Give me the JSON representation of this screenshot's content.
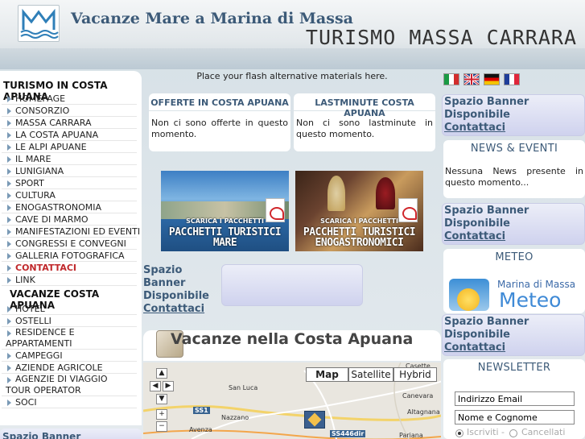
{
  "header": {
    "title": "Vacanze Mare a Marina di Massa",
    "subtitle": "TURISMO MASSA CARRARA"
  },
  "left_menu": {
    "section1_title": "TURISMO IN COSTA APUANA",
    "items": [
      "HOMEPAGE",
      "CONSORZIO",
      "MASSA CARRARA",
      "LA COSTA APUANA",
      "LE ALPI APUANE",
      "IL MARE",
      "LUNIGIANA",
      "SPORT",
      "CULTURA",
      "ENOGASTRONOMIA",
      "CAVE DI MARMO",
      "MANIFESTAZIONI ED EVENTI",
      "CONGRESSI E CONVEGNI",
      "GALLERIA FOTOGRAFICA",
      "CONTATTACI",
      "LINK"
    ],
    "section2_title": "VACANZE COSTA APUANA",
    "items2": [
      "HOTEL",
      "OSTELLI",
      "RESIDENCE E",
      "APPARTAMENTI",
      "CAMPEGGI",
      "AZIENDE AGRICOLE",
      "AGENZIE DI VIAGGIO",
      "TOUR OPERATOR",
      "SOCI"
    ],
    "bottom_banner": "Spazio Banner"
  },
  "center": {
    "flash_note": "Place your flash alternative materials here.",
    "offers_title": "OFFERTE IN COSTA APUANA",
    "offers_text": "Non ci sono offerte in questo momento.",
    "lastminute_title": "LASTMINUTE COSTA APUANA",
    "lastminute_text": "Non ci sono lastminute in questo momento.",
    "promo1_small": "SCARICA I PACCHETTI",
    "promo1_big1": "PACCHETTI TURISTICI",
    "promo1_big2": "MARE",
    "promo2_small": "SCARICA I PACCHETTI",
    "promo2_big1": "PACCHETTI TURISTICI",
    "promo2_big2": "ENOGASTRONOMICI",
    "banner_line1": "Spazio Banner",
    "banner_line2": "Disponibile",
    "banner_link": "Contattaci",
    "vacanze_title": "Vacanze nella Costa Apuana"
  },
  "map": {
    "types": [
      "Map",
      "Satellite",
      "Hybrid"
    ],
    "labels": [
      "San Luca",
      "Nazzano",
      "Avenza",
      "Canevara",
      "Altagnana",
      "Pariana",
      "Casette"
    ],
    "shields": [
      "SS1",
      "SS446dir"
    ]
  },
  "right": {
    "banner_line1": "Spazio Banner",
    "banner_line2": "Disponibile",
    "banner_link": "Contattaci",
    "news_title": "NEWS & EVENTI",
    "news_text": "Nessuna News presente in questo momento...",
    "meteo_title": "METEO",
    "meteo_place": "Marina di Massa",
    "meteo_word": "Meteo",
    "newsletter_title": "NEWSLETTER",
    "email_value": "Indirizzo Email",
    "name_value": "Nome e Cognome",
    "subscribe_label": "Iscriviti",
    "separator": "-",
    "unsubscribe_label": "Cancellati"
  },
  "colors": {
    "accent": "#3c5a78",
    "active_menu": "#c0282b",
    "banner": "#d7d8f0"
  }
}
